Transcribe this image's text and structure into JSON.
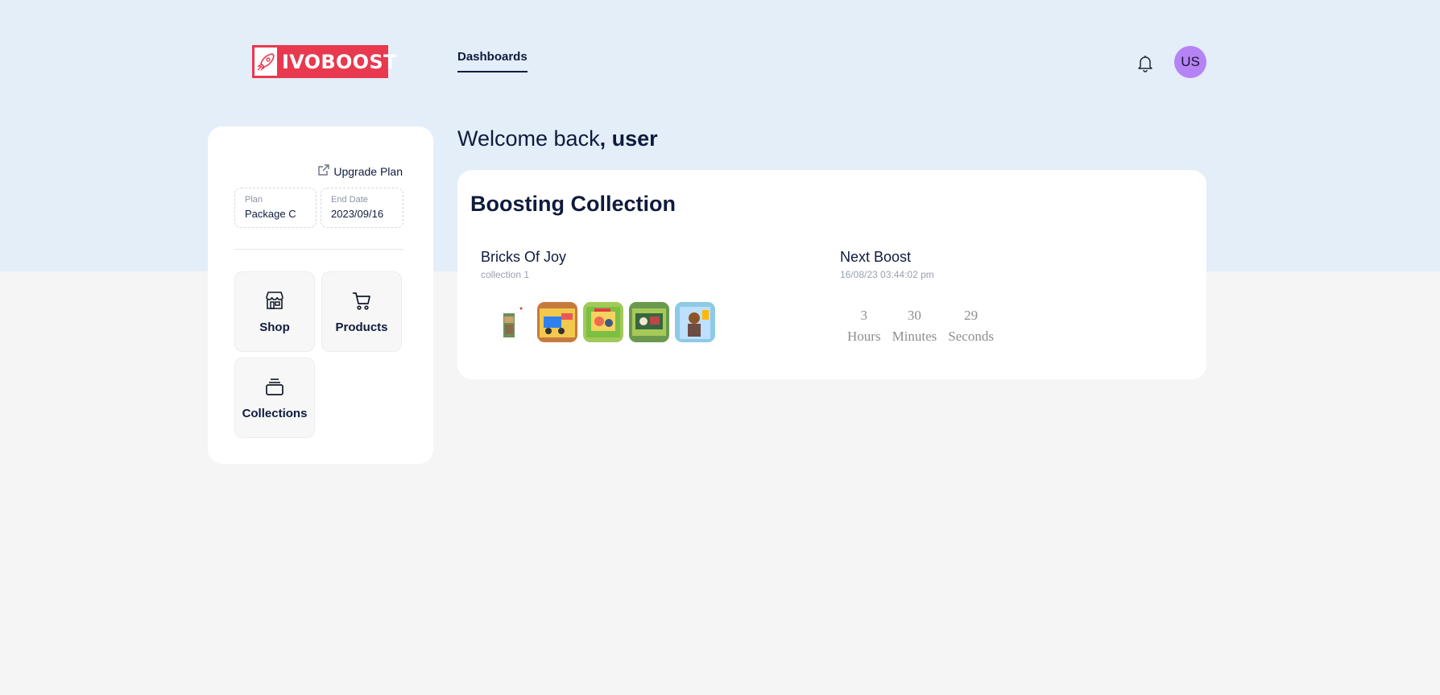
{
  "header": {
    "logo_text": "IVOBOOST",
    "nav_dashboards": "Dashboards",
    "avatar_initials": "US"
  },
  "sidebar": {
    "upgrade_label": "Upgrade Plan",
    "plan_label": "Plan",
    "plan_value": "Package C",
    "end_date_label": "End Date",
    "end_date_value": "2023/09/16",
    "tiles": [
      {
        "label": "Shop",
        "icon": "shop-icon"
      },
      {
        "label": "Products",
        "icon": "cart-icon"
      },
      {
        "label": "Collections",
        "icon": "collections-icon"
      }
    ]
  },
  "main": {
    "welcome_prefix": "Welcome back",
    "welcome_user": ", user",
    "card_title": "Boosting Collection",
    "collection_name": "Bricks Of Joy",
    "collection_sub": "collection 1",
    "next_boost_title": "Next Boost",
    "next_boost_date": "16/08/23 03:44:02 pm",
    "countdown": [
      {
        "value": "3",
        "label": "Hours"
      },
      {
        "value": "30",
        "label": "Minutes"
      },
      {
        "value": "29",
        "label": "Seconds"
      }
    ]
  },
  "colors": {
    "accent": "#e8394f",
    "top_band": "#e3eef9",
    "avatar": "#b583f5",
    "text_dark": "#0f1b3d"
  }
}
